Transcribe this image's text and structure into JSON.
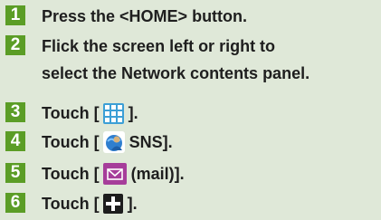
{
  "steps": [
    {
      "num": "1",
      "text": "Press the <HOME> button."
    },
    {
      "num": "2",
      "lines": [
        "Flick the screen left or right to",
        "select the Network contents panel."
      ]
    },
    {
      "num": "3",
      "before": "Touch [",
      "icon": "grid-icon",
      "after": "]."
    },
    {
      "num": "4",
      "before": "Touch [",
      "icon": "globe-user-icon",
      "after": "SNS]."
    },
    {
      "num": "5",
      "before": "Touch [",
      "icon": "mail-icon",
      "after": "(mail)]."
    },
    {
      "num": "6",
      "before": "Touch [",
      "icon": "plus-icon",
      "after": "]."
    }
  ],
  "colors": {
    "background": "#dfe8d8",
    "step_badge": "#5b9d26",
    "text": "#1e1e1e",
    "mail_icon": "#a63d9a"
  }
}
